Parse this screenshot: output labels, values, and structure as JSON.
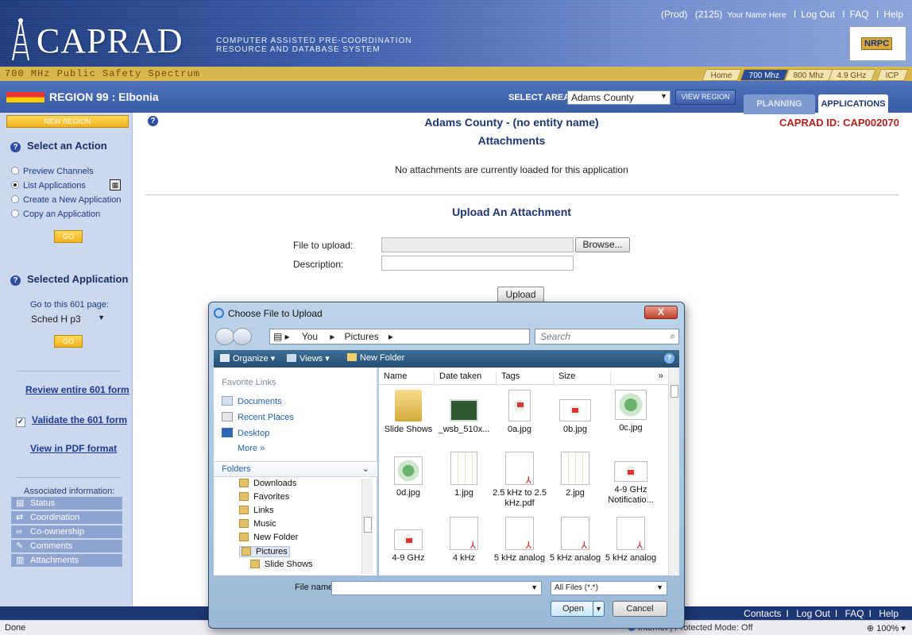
{
  "header": {
    "env": "(Prod)",
    "user_id": "(2125)",
    "user_name": "Your Name Here",
    "links": [
      "Log Out",
      "FAQ",
      "Help"
    ],
    "logo": "CAPRAD",
    "subtitle_line1": "COMPUTER ASSISTED PRE-COORDINATION",
    "subtitle_line2": "RESOURCE AND DATABASE SYSTEM",
    "badge": "NRPC"
  },
  "spectrum": {
    "title": "700 MHz Public Safety Spectrum",
    "tabs": [
      "Home",
      "700 Mhz",
      "800 Mhz",
      "4.9 GHz",
      "ICP"
    ],
    "active_tab": "700 Mhz"
  },
  "region": {
    "title": "REGION 99 : Elbonia",
    "select_area_label": "SELECT AREA:",
    "select_area_value": "Adams County",
    "view_region_button": "VIEW REGION",
    "tabs": [
      "PLANNING",
      "APPLICATIONS"
    ],
    "active_tab": "APPLICATIONS"
  },
  "sidebar": {
    "new_region_button": "NEW REGION",
    "select_action_title": "Select an Action",
    "actions": [
      "Preview Channels",
      "List Applications",
      "Create a New Application",
      "Copy an Application"
    ],
    "selected_action": "List Applications",
    "go_label": "GO",
    "selected_app_title": "Selected Application",
    "goto_label": "Go to this 601 page:",
    "goto_value": "Sched H p3",
    "review_link": "Review entire 601 form",
    "validate_link": "Validate the 601 form",
    "pdf_link": "View in PDF format",
    "assoc_label": "Associated information:",
    "assoc_items": [
      "Status",
      "Coordination",
      "Co-ownership",
      "Comments",
      "Attachments"
    ]
  },
  "main": {
    "entity_title": "Adams County - (no entity name)",
    "section_title": "Attachments",
    "caprad_id": "CAPRAD ID: CAP002070",
    "no_attachments": "No attachments are currently loaded for this application",
    "upload_title": "Upload An Attachment",
    "file_label": "File to upload:",
    "browse_button": "Browse...",
    "desc_label": "Description:",
    "upload_button": "Upload"
  },
  "dialog": {
    "title": "Choose File to Upload",
    "close": "X",
    "path": [
      "You",
      "Pictures"
    ],
    "search_placeholder": "Search",
    "toolbar": [
      "Organize",
      "Views",
      "New Folder"
    ],
    "fav_header": "Favorite Links",
    "favorites": [
      "Documents",
      "Recent Places",
      "Desktop"
    ],
    "more": "More »",
    "folders_header": "Folders",
    "folders": [
      "Downloads",
      "Favorites",
      "Links",
      "Music",
      "New Folder",
      "Pictures",
      "Slide Shows"
    ],
    "selected_folder": "Pictures",
    "columns": [
      "Name",
      "Date taken",
      "Tags",
      "Size"
    ],
    "files_row1": [
      "Slide Shows",
      "_wsb_510x...",
      "0a.jpg",
      "0b.jpg",
      "0c.jpg"
    ],
    "files_row2": [
      "0d.jpg",
      "1.jpg",
      "2.5 kHz to 2.5 kHz.pdf",
      "2.jpg",
      "4-9 GHz Notificatio..."
    ],
    "files_row3": [
      "4-9 GHz",
      "4 kHz",
      "5 kHz analog",
      "5 kHz analog",
      "5 kHz analog"
    ],
    "file_name_label": "File name:",
    "file_name_value": "",
    "file_type": "All Files (*.*)",
    "open_button": "Open",
    "cancel_button": "Cancel"
  },
  "footer": {
    "links": [
      "Contacts",
      "Log Out",
      "FAQ",
      "Help"
    ]
  },
  "statusbar": {
    "status": "Done",
    "zone": "Internet | Protected Mode: Off",
    "zoom": "100%"
  }
}
